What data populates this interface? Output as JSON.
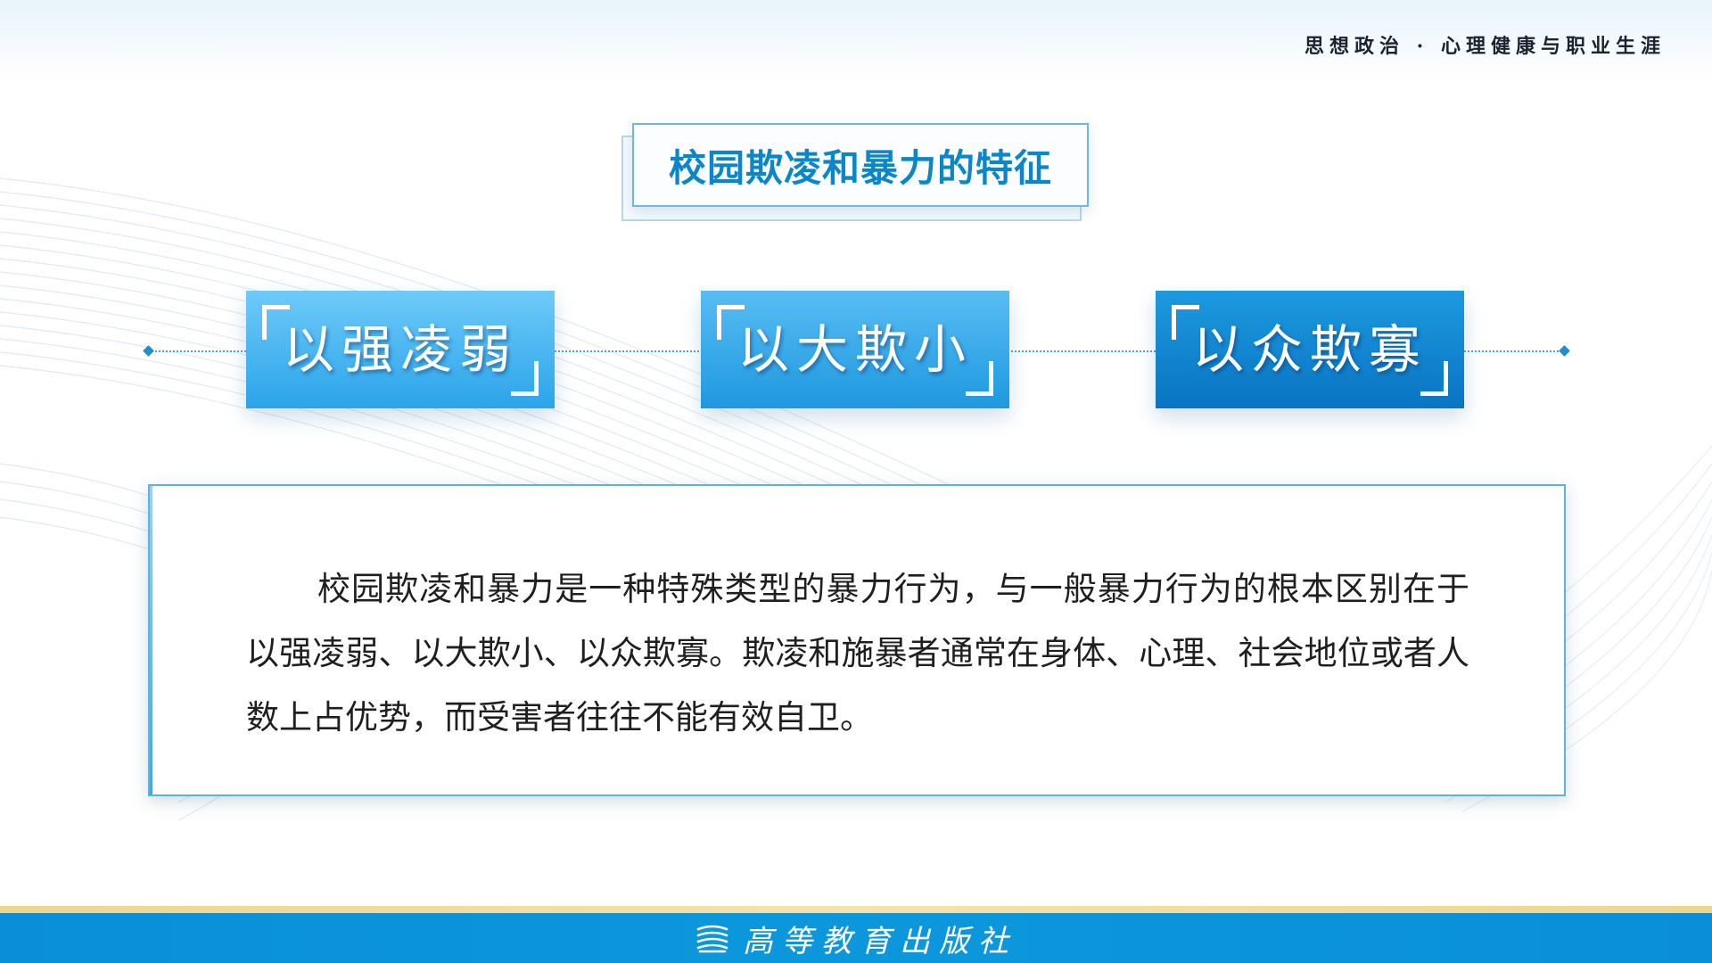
{
  "header": {
    "course_title": "思想政治 · 心理健康与职业生涯"
  },
  "slide": {
    "title": "校园欺凌和暴力的特征"
  },
  "tags": [
    {
      "label": "以强凌弱"
    },
    {
      "label": "以大欺小"
    },
    {
      "label": "以众欺寡"
    }
  ],
  "content": {
    "paragraph": "校园欺凌和暴力是一种特殊类型的暴力行为，与一般暴力行为的根本区别在于以强凌弱、以大欺小、以众欺寡。欺凌和施暴者通常在身体、心理、社会地位或者人数上占优势，而受害者往往不能有效自卫。"
  },
  "footer": {
    "publisher": "高等教育出版社",
    "logo_icon": "books-icon"
  },
  "colors": {
    "accent_blue": "#0a86c9",
    "footer_blue": "#0a8fd6",
    "footer_gold": "#f0d58c"
  }
}
